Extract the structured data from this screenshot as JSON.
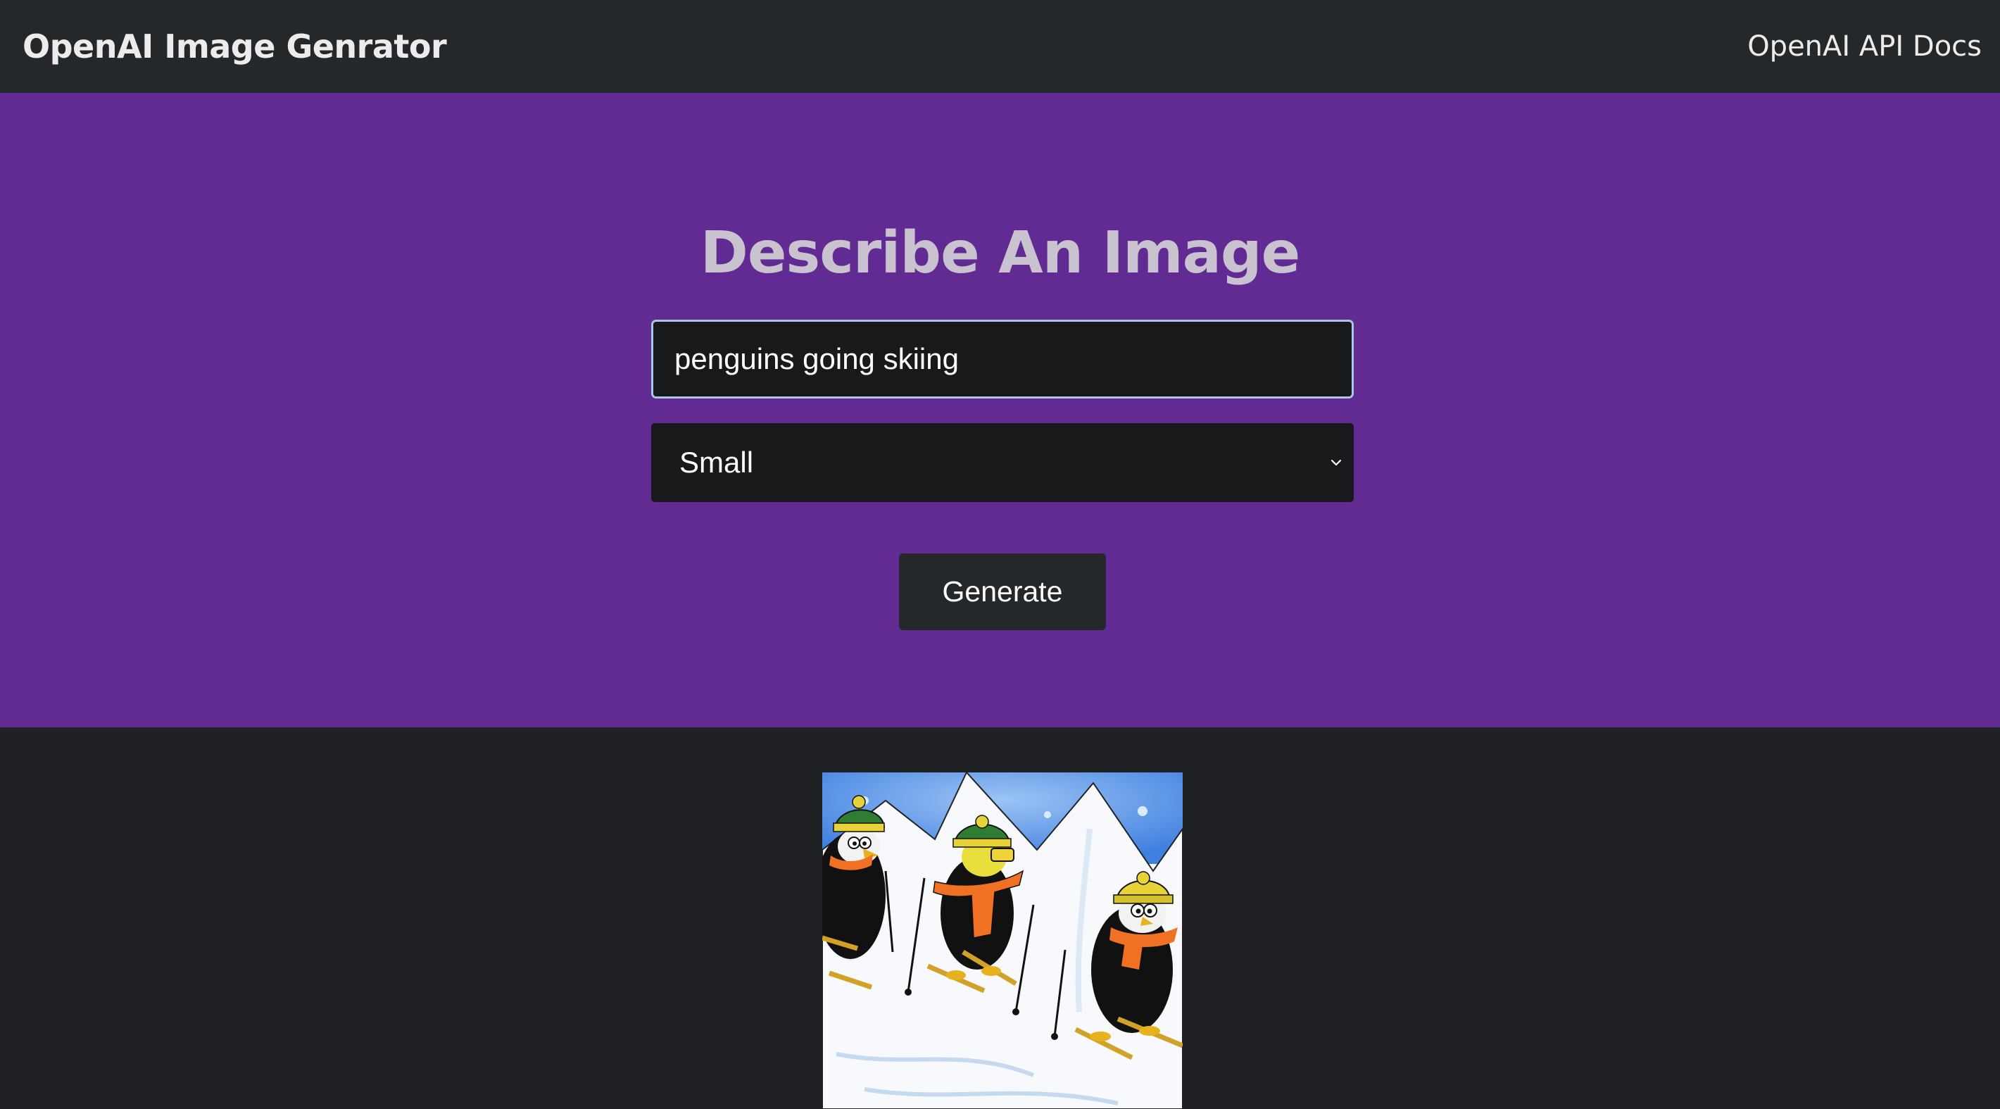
{
  "navbar": {
    "brand": "OpenAI Image Genrator",
    "docs_link": "OpenAI API Docs"
  },
  "showcase": {
    "heading": "Describe An Image",
    "prompt_value": "penguins going skiing",
    "size_select": {
      "selected": "Small",
      "icon": "chevron-down-icon"
    },
    "generate_label": "Generate"
  },
  "result": {
    "image_subject": "penguins going skiing"
  },
  "colors": {
    "navbar_bg": "#25282a",
    "showcase_bg": "#622a93",
    "page_bg": "#202124",
    "heading": "#c9c3cf",
    "input_bg": "#17191b",
    "input_focus_border": "#a9c4e6"
  }
}
